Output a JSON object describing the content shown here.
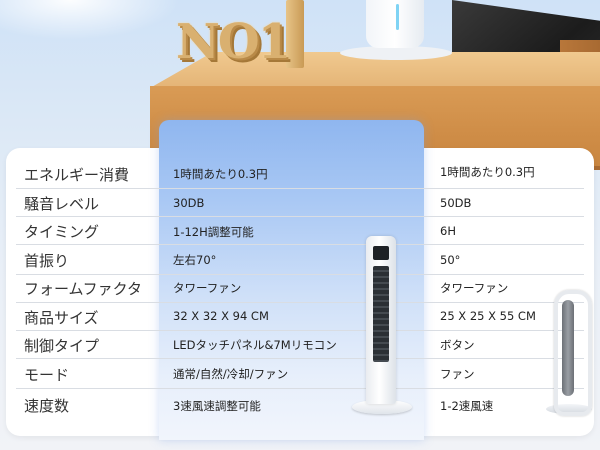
{
  "hero": {
    "logo_text": "NO1"
  },
  "table": {
    "rows": [
      {
        "label": "エネルギー消費",
        "product_a": "1時間あたり0.3円",
        "product_b": "1時間あたり0.3円"
      },
      {
        "label": "騒音レベル",
        "product_a": "30DB",
        "product_b": "50DB"
      },
      {
        "label": "タイミング",
        "product_a": "1-12H調整可能",
        "product_b": "6H"
      },
      {
        "label": "首振り",
        "product_a": "左右70°",
        "product_b": "50°"
      },
      {
        "label": "フォームファクタ",
        "product_a": "タワーファン",
        "product_b": "タワーファン"
      },
      {
        "label": "商品サイズ",
        "product_a": "32 X 32 X 94 CM",
        "product_b": "25 X 25 X 55 CM"
      },
      {
        "label": "制御タイプ",
        "product_a": "LEDタッチパネル&7Mリモコン",
        "product_b": "ボタン"
      },
      {
        "label": "モード",
        "product_a": "通常/自然/冷却/ファン",
        "product_b": "ファン"
      },
      {
        "label": "速度数",
        "product_a": "3速風速調整可能",
        "product_b": "1-2速風速"
      }
    ],
    "highlight_color": "#8fb6ef"
  },
  "images": {
    "product_a": "white-tower-fan-icon",
    "product_b": "loop-tower-fan-icon"
  }
}
